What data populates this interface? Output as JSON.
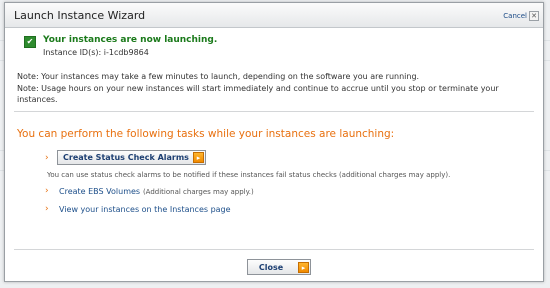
{
  "dialog": {
    "title": "Launch Instance Wizard",
    "cancel_label": "Cancel",
    "close_glyph": "✕"
  },
  "status": {
    "icon": "check-icon",
    "title": "Your instances are now launching.",
    "instance_ids": "Instance ID(s):  i-1cdb9864"
  },
  "notes": [
    "Note: Your instances may take a few minutes to launch, depending on the software you are running.",
    "Note: Usage hours on your new instances will start immediately and continue to accrue until you stop or terminate your instances."
  ],
  "tasks": {
    "heading": "You can perform the following tasks while your instances are launching:",
    "status_check_button": "Create Status Check Alarms",
    "status_check_help": "You can use status check alarms to be notified if these instances fail status checks (additional charges may apply).",
    "ebs_link": "Create EBS Volumes",
    "ebs_note": "(Additional charges may apply.)",
    "view_link": "View your instances on the Instances page"
  },
  "footer": {
    "close_label": "Close"
  },
  "colors": {
    "success_green": "#1b7a1b",
    "heading_orange": "#e8700f",
    "link_blue": "#1d4f8a",
    "button_arrow_orange": "#f08a00"
  }
}
